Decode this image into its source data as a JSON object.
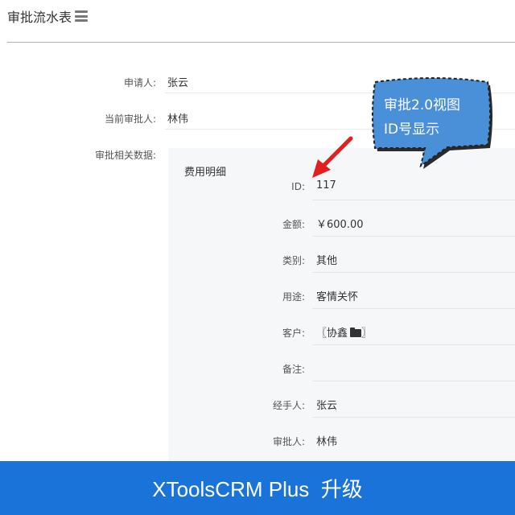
{
  "header": {
    "title": "审批流水表"
  },
  "fields": {
    "applicant_label": "申请人:",
    "applicant_value": "张云",
    "current_approver_label": "当前审批人:",
    "current_approver_value": "林伟",
    "related_data_label": "审批相关数据:"
  },
  "expense": {
    "title": "费用明细",
    "rows": [
      {
        "label": "ID:",
        "value": "117"
      },
      {
        "label": "金额:",
        "value": "￥600.00"
      },
      {
        "label": "类别:",
        "value": "其他"
      },
      {
        "label": "用途:",
        "value": "客情关怀"
      },
      {
        "label": "客户:",
        "value": "〖协鑫",
        "suffix": "〗"
      },
      {
        "label": "备注:",
        "value": ""
      },
      {
        "label": "经手人:",
        "value": "张云"
      },
      {
        "label": "审批人:",
        "value": "林伟"
      }
    ]
  },
  "callout": {
    "line1": "审批2.0视图",
    "line2": "ID号显示",
    "color": "#4a90d9"
  },
  "banner": {
    "text": "XToolsCRM Plus  升级",
    "color": "#1a73d8"
  }
}
